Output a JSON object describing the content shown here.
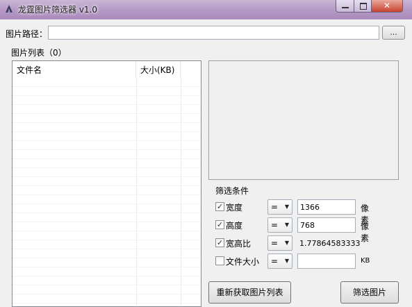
{
  "window": {
    "title": "龙霆图片筛选器 v1.0",
    "minimize_icon": "minimize-icon",
    "maximize_icon": "maximize-icon",
    "close_glyph": "✕"
  },
  "path": {
    "label": "图片路径：",
    "value": "",
    "browse_label": "..."
  },
  "list": {
    "group_label": "图片列表（0）",
    "columns": [
      "文件名",
      "大小(KB)"
    ],
    "rows": []
  },
  "filters": {
    "group_label": "筛选条件",
    "items": [
      {
        "label": "宽度",
        "checked": true,
        "operator": "=",
        "value": "1366",
        "unit": "像素"
      },
      {
        "label": "高度",
        "checked": true,
        "operator": "=",
        "value": "768",
        "unit": "像素"
      },
      {
        "label": "宽高比",
        "checked": true,
        "operator": "=",
        "value": "1.77864583333",
        "unit": ""
      },
      {
        "label": "文件大小",
        "checked": false,
        "operator": "=",
        "value": "",
        "unit": "KB"
      }
    ],
    "check_glyph": "✓",
    "dropdown_glyph": "▼"
  },
  "actions": {
    "refresh_label": "重新获取图片列表",
    "filter_label": "筛选图片"
  }
}
